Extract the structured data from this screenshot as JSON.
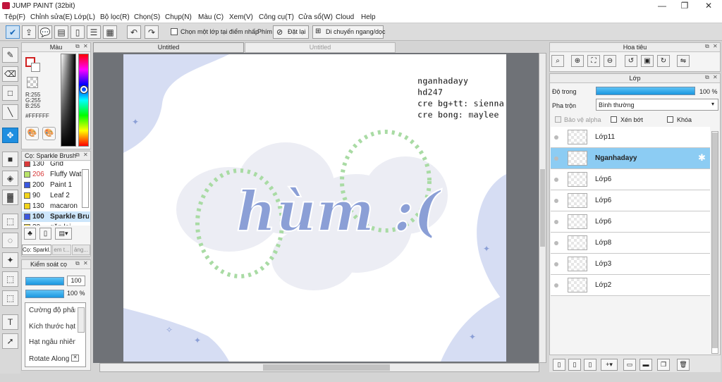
{
  "app": {
    "title": "JUMP PAINT (32bit)"
  },
  "menu": [
    "Tệp(F)",
    "Chỉnh sửa(E)",
    "Lớp(L)",
    "Bộ lọc(R)",
    "Chọn(S)",
    "Chụp(N)",
    "Màu (C)",
    "Xem(V)",
    "Công cụ(T)",
    "Cửa sổ(W)",
    "Cloud",
    "Help"
  ],
  "toolbar": {
    "select_layer_label": "Chọn một lớp tại điểm nhấp",
    "keys_label": "Phím",
    "reset_label": "Đặt lại",
    "move_label": "Di chuyển ngang/dọc"
  },
  "tabs": [
    {
      "label": "Untitled"
    },
    {
      "label": "Untitled"
    }
  ],
  "color_panel": {
    "title": "Màu",
    "r": "R:255",
    "g": "G:255",
    "b": "B:255",
    "hex": "#FFFFFF"
  },
  "brush_panel": {
    "title": "Cọ: Sparkle Brush",
    "items": [
      {
        "value": "130",
        "name": "Grid",
        "color": "#d83a3a",
        "value_color": "#222"
      },
      {
        "value": "206",
        "name": "Fluffy Water",
        "color": "#b9e36a",
        "value_color": "#d83a3a"
      },
      {
        "value": "200",
        "name": "Paint 1",
        "color": "#3a58e0",
        "value_color": "#222"
      },
      {
        "value": "90",
        "name": "Leaf 2",
        "color": "#f2d41a",
        "value_color": "#222"
      },
      {
        "value": "130",
        "name": "macaron",
        "color": "#f2d41a",
        "value_color": "#222"
      },
      {
        "value": "100",
        "name": "Sparkle Brush",
        "color": "#3a58e0",
        "value_color": "#222"
      },
      {
        "value": "30",
        "name": "gắn lại",
        "color": "#f2d41a",
        "value_color": "#222"
      }
    ],
    "tabs": [
      "Cọ: Sparkl..",
      "em t...",
      "ảng..."
    ]
  },
  "brush_control": {
    "title": "Kiểm soát cọ",
    "size": "100",
    "opacity": "100 %",
    "labels": [
      "Cường độ phân tán",
      "Kích thước hạt",
      "Hạt ngẫu nhiên",
      "Rotate Along"
    ]
  },
  "navigator": {
    "title": "Hoa tiêu"
  },
  "layers": {
    "title": "Lớp",
    "opacity_label": "Độ trong",
    "opacity_value": "100 %",
    "opacity_fraction": 1.0,
    "blend_label": "Pha trộn",
    "blend_value": "Bình thường",
    "protect_alpha": "Bảo vệ alpha",
    "clipping": "Xén bớt",
    "lock": "Khóa",
    "items": [
      {
        "name": "Lớp11",
        "selected": false
      },
      {
        "name": "Nganhadayy",
        "selected": true
      },
      {
        "name": "Lớp6",
        "selected": false
      },
      {
        "name": "Lớp6",
        "selected": false
      },
      {
        "name": "Lớp6",
        "selected": false
      },
      {
        "name": "Lớp8",
        "selected": false
      },
      {
        "name": "Lớp3",
        "selected": false
      },
      {
        "name": "Lớp2",
        "selected": false
      }
    ]
  },
  "artwork": {
    "credits": [
      "nganhadayy",
      "hd247",
      "cre bg+tt: sienna",
      "cre bong: maylee"
    ],
    "main_text": "hùm :("
  },
  "colors": {
    "accent": "#1e8ee0",
    "selected_layer": "#8cccf3",
    "artwork_blue": "#8b9fd6",
    "paper_blue": "#d6ddf3"
  }
}
